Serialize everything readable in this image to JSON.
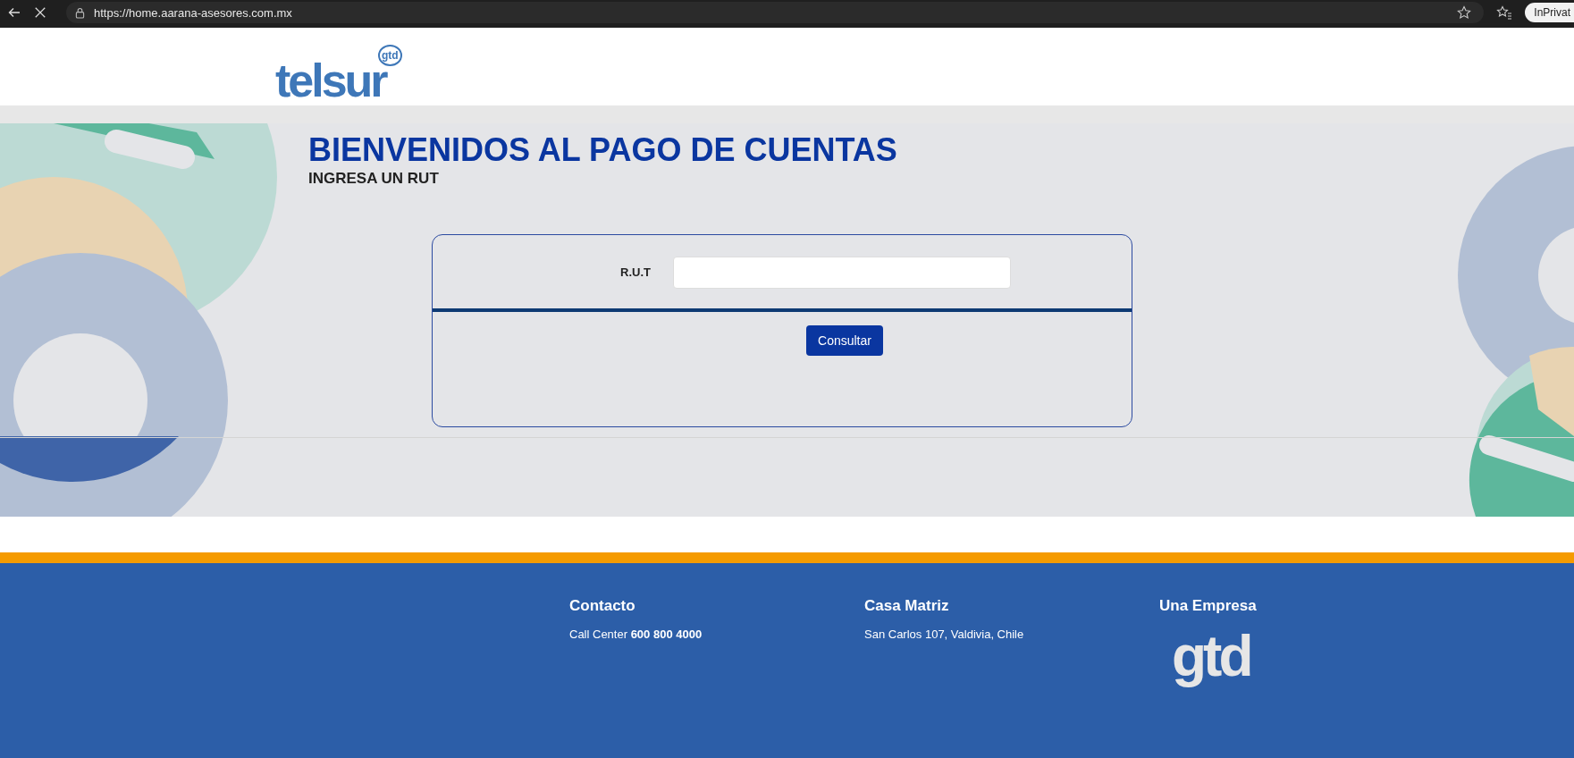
{
  "browser": {
    "url": "https://home.aarana-asesores.com.mx",
    "badge": "InPrivat"
  },
  "header": {
    "logo_text": "telsur",
    "logo_badge": "gtd"
  },
  "main": {
    "title": "BIENVENIDOS AL PAGO DE CUENTAS",
    "subtitle": "INGRESA UN RUT",
    "form": {
      "label": "R.U.T",
      "button": "Consultar"
    }
  },
  "footer": {
    "columns": [
      {
        "kind": "text",
        "heading": "Contacto",
        "text": "Call Center **600 800 4000**"
      },
      {
        "kind": "text",
        "heading": "Casa Matriz",
        "text": "San Carlos 107, Valdivia, Chile"
      },
      {
        "kind": "logo",
        "heading": "Una Empresa",
        "text": "gtd"
      }
    ]
  }
}
